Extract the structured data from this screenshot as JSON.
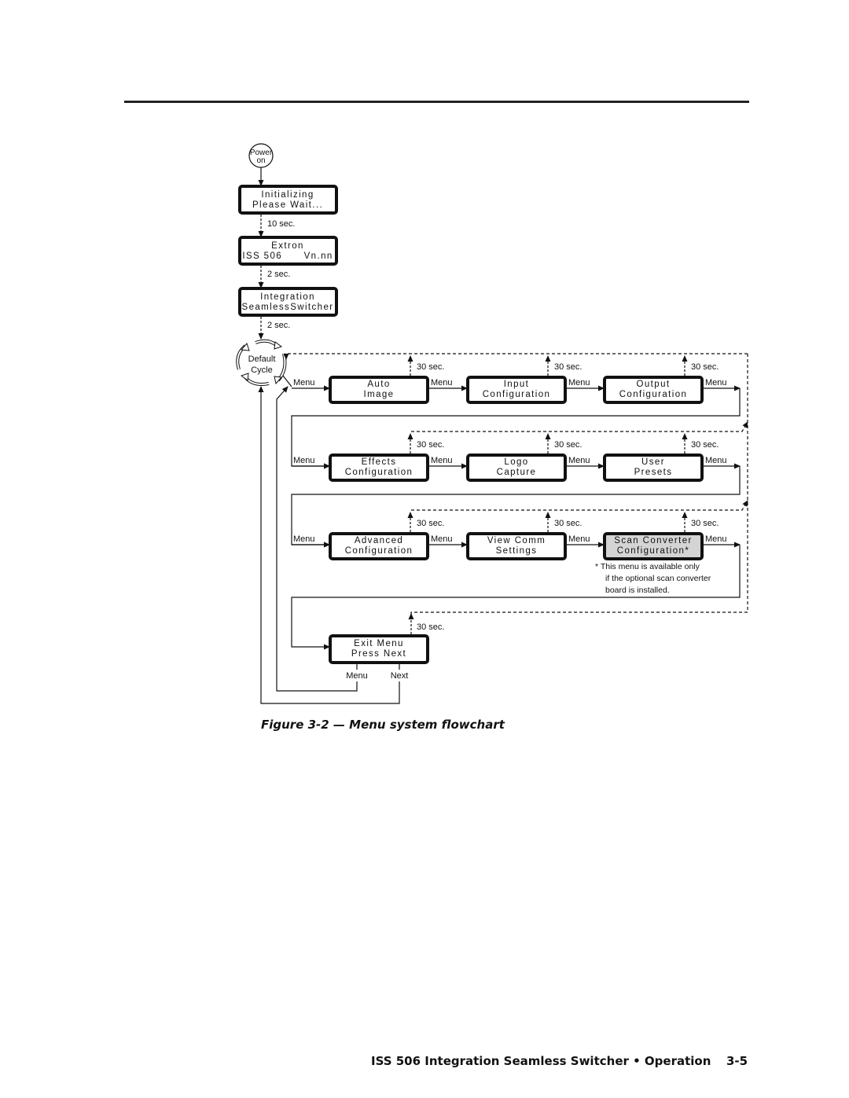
{
  "start": {
    "label_line1": "Power",
    "label_line2": "on"
  },
  "boot_screens": [
    {
      "line1": "Initializing",
      "line2": "Please Wait...",
      "delay": "10 sec."
    },
    {
      "line1": "Extron",
      "line2": "ISS 506      Vn.nn",
      "delay": "2 sec."
    },
    {
      "line1": "Integration",
      "line2": "SeamlessSwitcher",
      "delay": "2 sec."
    }
  ],
  "default_cycle": {
    "line1": "Default",
    "line2": "Cycle"
  },
  "menu_label": "Menu",
  "timeout_label": "30 sec.",
  "menus": [
    {
      "line1": "Auto",
      "line2": "Image",
      "highlight": false
    },
    {
      "line1": "Input",
      "line2": "Configuration",
      "highlight": false
    },
    {
      "line1": "Output",
      "line2": "Configuration",
      "highlight": false
    },
    {
      "line1": "Effects",
      "line2": "Configuration",
      "highlight": false
    },
    {
      "line1": "Logo",
      "line2": "Capture",
      "highlight": false
    },
    {
      "line1": "User",
      "line2": "Presets",
      "highlight": false
    },
    {
      "line1": "Advanced",
      "line2": "Configuration",
      "highlight": false
    },
    {
      "line1": "View Comm",
      "line2": "Settings",
      "highlight": false
    },
    {
      "line1": "Scan Converter",
      "line2": "Configuration*",
      "highlight": true
    }
  ],
  "exit_menu": {
    "line1": "Exit Menu",
    "line2": "Press Next",
    "btn_menu": "Menu",
    "btn_next": "Next"
  },
  "footnote": [
    "*  This menu is available only",
    "if the optional scan converter",
    "board is installed."
  ],
  "colors": {
    "highlight_fill": "#d4d4d4",
    "line": "#111111"
  },
  "caption": "Figure 3-2 — Menu system flowchart",
  "footer": {
    "title": "ISS 506 Integration Seamless Switcher • Operation",
    "page": "3-5"
  }
}
